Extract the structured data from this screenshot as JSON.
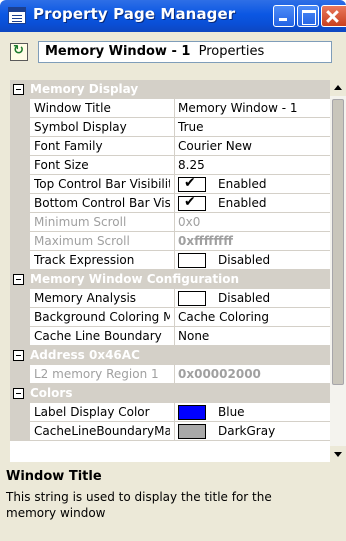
{
  "window": {
    "title": "Property Page Manager",
    "icon": "property-page-icon",
    "controls": [
      "minimize-icon",
      "maximize-icon",
      "close-icon"
    ]
  },
  "toolbar": {
    "object_icon": "refresh-object-icon",
    "selected_object": "Memory Window - 1",
    "object_kind": "Properties"
  },
  "grid": {
    "memory_display": {
      "label": "Memory Display",
      "window_title": {
        "name": "Window Title",
        "value": "Memory Window - 1"
      },
      "symbol_display": {
        "name": "Symbol Display",
        "value": "True"
      },
      "font_family": {
        "name": "Font Family",
        "value": "Courier New"
      },
      "font_size": {
        "name": "Font Size",
        "value": "8.25"
      },
      "top_control_bar": {
        "name": "Top Control Bar Visibility",
        "value": "Enabled",
        "checked": true
      },
      "bottom_control_bar": {
        "name": "Bottom Control Bar Visibility",
        "value": "Enabled",
        "checked": true
      },
      "minimum_scroll": {
        "name": "Minimum Scroll",
        "value": "0x0"
      },
      "maximum_scroll": {
        "name": "Maximum Scroll",
        "value": "0xffffffff"
      },
      "track_expression": {
        "name": "Track Expression",
        "value": "Disabled",
        "checked": false
      }
    },
    "memory_window_configuration": {
      "label": "Memory Window Configuration",
      "memory_analysis": {
        "name": "Memory Analysis",
        "value": "Disabled",
        "checked": false
      },
      "background_coloring": {
        "name": "Background Coloring Mode",
        "value": "Cache Coloring"
      },
      "cache_line_boundary": {
        "name": "Cache Line Boundary",
        "value": "None"
      }
    },
    "address": {
      "label": "Address 0x46AC",
      "l2_memory_region": {
        "name": "L2 memory Region 1",
        "value": "0x00002000"
      }
    },
    "colors": {
      "label": "Colors",
      "label_display_color": {
        "name": "Label Display Color",
        "value": "Blue",
        "swatch": "#0000ff"
      },
      "cache_line_boundary_color": {
        "name": "CacheLineBoundaryMarker",
        "value": "DarkGray",
        "swatch": "#a9a9a9"
      }
    }
  },
  "help": {
    "title": "Window Title",
    "description": "This string is used to display the title for the memory window"
  },
  "theme": {
    "titlebar": "#0b57e3",
    "frame": "#ece9d8",
    "category_row": "#d4d0c8"
  }
}
